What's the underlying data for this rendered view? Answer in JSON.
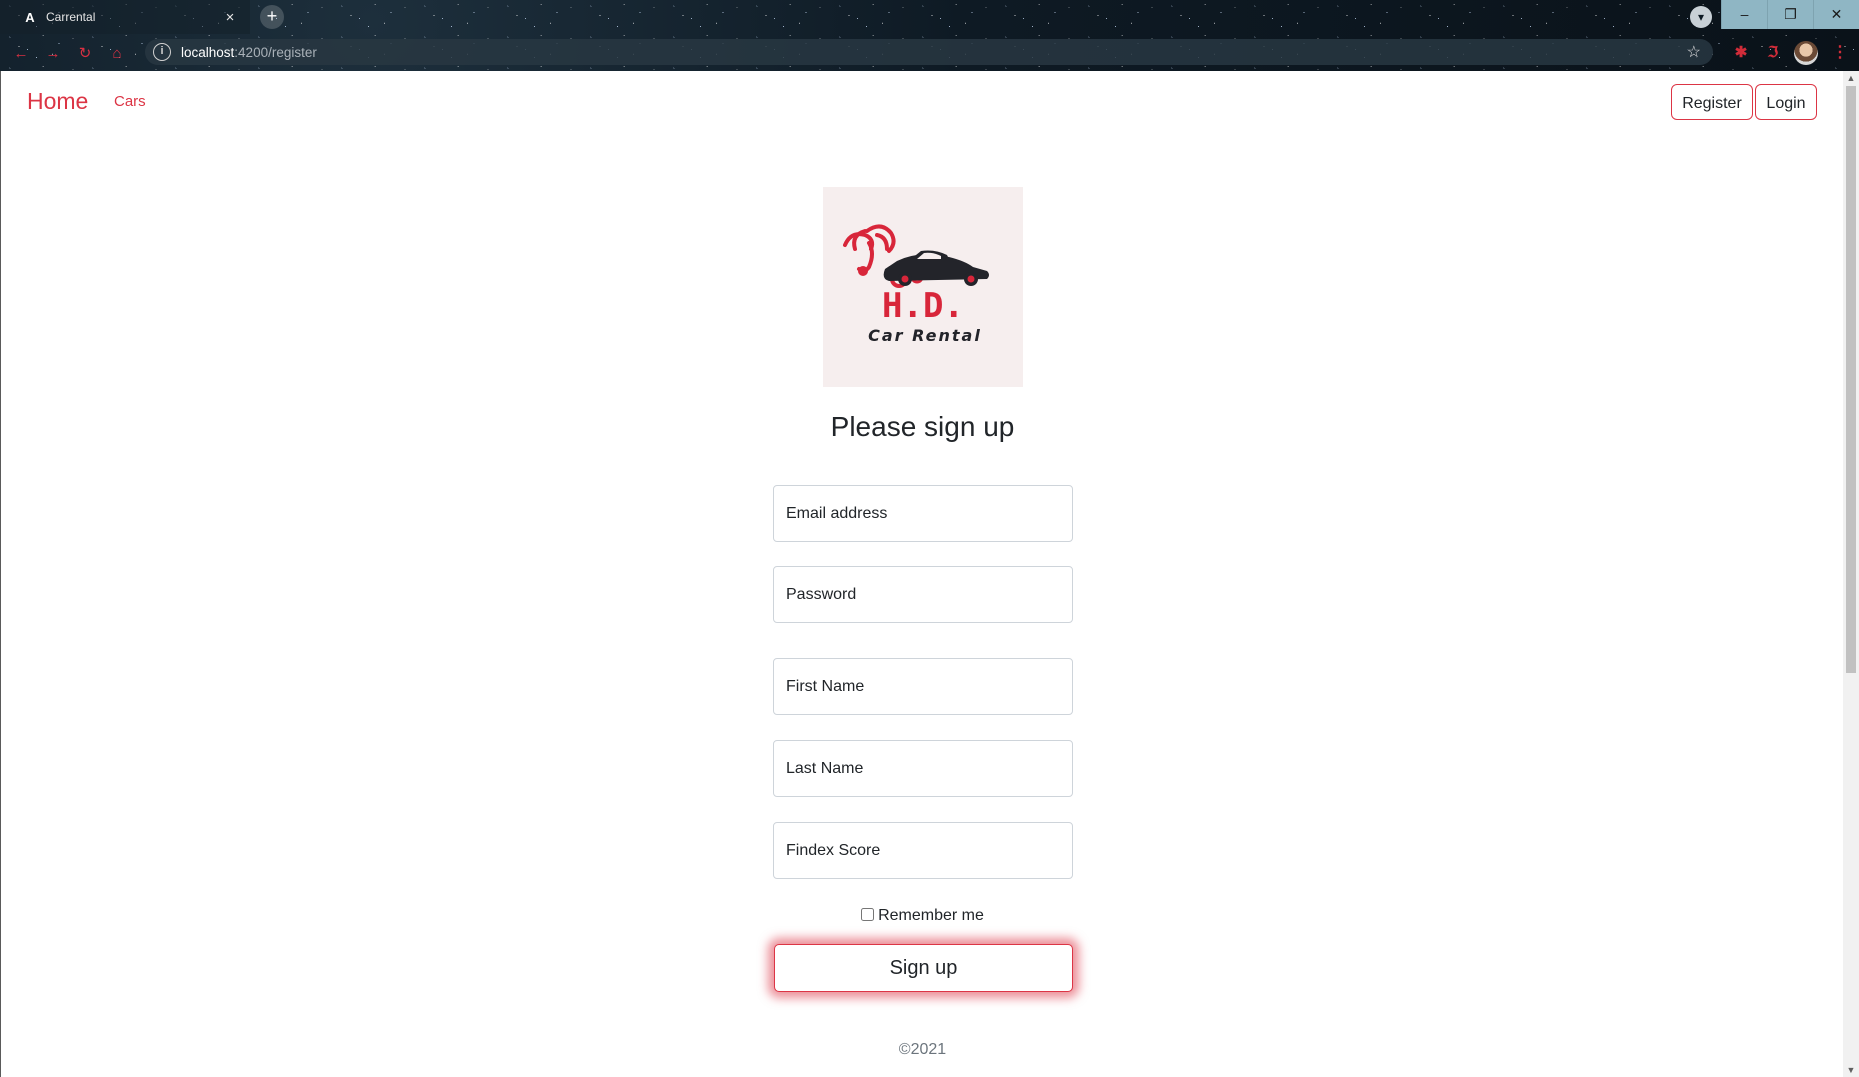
{
  "browser": {
    "tab_title": "Carrental",
    "tab_close": "×",
    "new_tab": "+",
    "url_host": "localhost",
    "url_rest": ":4200/register",
    "window_controls": {
      "minimize": "–",
      "restore": "❐",
      "close": "✕"
    }
  },
  "nav": {
    "home": "Home",
    "cars": "Cars",
    "register": "Register",
    "login": "Login"
  },
  "logo": {
    "line1": "H.D.",
    "line2": "Car Rental"
  },
  "form": {
    "heading": "Please sign up",
    "email_placeholder": "Email address",
    "password_placeholder": "Password",
    "first_name_placeholder": "First Name",
    "last_name_placeholder": "Last Name",
    "findex_placeholder": "Findex Score",
    "remember_label": "Remember me",
    "submit_label": "Sign up"
  },
  "footer": {
    "copyright": "©2021"
  },
  "colors": {
    "accent": "#dc3545",
    "text": "#212529",
    "muted": "#6c757d",
    "logo_bg": "#f6eeee"
  }
}
